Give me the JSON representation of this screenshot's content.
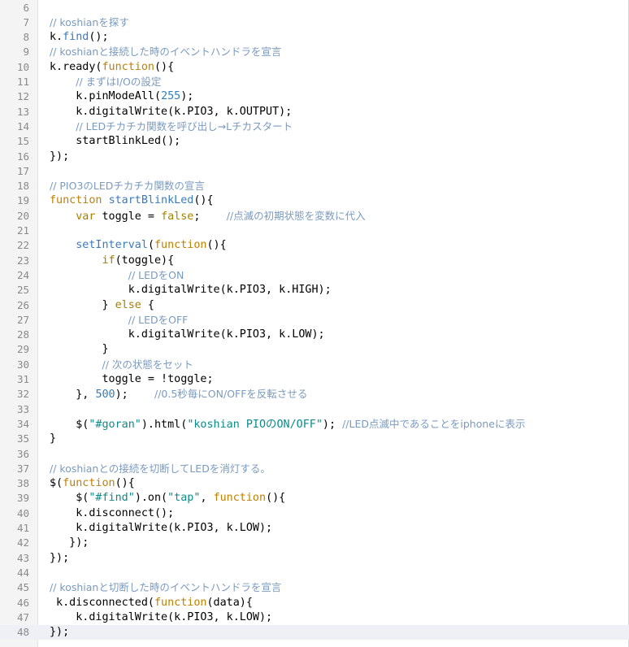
{
  "editor": {
    "lines": [
      {
        "n": "6",
        "t": []
      },
      {
        "n": "7",
        "t": [
          {
            "c": "com",
            "v": "// koshianを探す"
          }
        ]
      },
      {
        "n": "8",
        "t": [
          {
            "c": "obj",
            "v": "k."
          },
          {
            "c": "fn",
            "v": "find"
          },
          {
            "c": "obj",
            "v": "();"
          }
        ]
      },
      {
        "n": "9",
        "t": [
          {
            "c": "com",
            "v": "// koshianと接続した時のイベントハンドラを宣言"
          }
        ]
      },
      {
        "n": "10",
        "t": [
          {
            "c": "obj",
            "v": "k.ready("
          },
          {
            "c": "kw",
            "v": "function"
          },
          {
            "c": "obj",
            "v": "(){"
          }
        ]
      },
      {
        "n": "11",
        "t": [
          {
            "c": "obj",
            "v": "    "
          },
          {
            "c": "com",
            "v": "// まずはI/Oの設定"
          }
        ]
      },
      {
        "n": "12",
        "t": [
          {
            "c": "obj",
            "v": "    k.pinModeAll("
          },
          {
            "c": "num",
            "v": "255"
          },
          {
            "c": "obj",
            "v": ");"
          }
        ]
      },
      {
        "n": "13",
        "t": [
          {
            "c": "obj",
            "v": "    k.digitalWrite(k.PIO3, k.OUTPUT);"
          }
        ]
      },
      {
        "n": "14",
        "t": [
          {
            "c": "obj",
            "v": "    "
          },
          {
            "c": "com",
            "v": "// LEDチカチカ関数を呼び出し→Lチカスタート"
          }
        ]
      },
      {
        "n": "15",
        "t": [
          {
            "c": "obj",
            "v": "    startBlinkLed();"
          }
        ]
      },
      {
        "n": "16",
        "t": [
          {
            "c": "obj",
            "v": "});"
          }
        ]
      },
      {
        "n": "17",
        "t": []
      },
      {
        "n": "18",
        "t": [
          {
            "c": "com",
            "v": "// PIO3のLEDチカチカ関数の宣言"
          }
        ]
      },
      {
        "n": "19",
        "t": [
          {
            "c": "kw",
            "v": "function"
          },
          {
            "c": "obj",
            "v": " "
          },
          {
            "c": "fn",
            "v": "startBlinkLed"
          },
          {
            "c": "obj",
            "v": "(){"
          }
        ]
      },
      {
        "n": "20",
        "t": [
          {
            "c": "obj",
            "v": "    "
          },
          {
            "c": "kw2",
            "v": "var"
          },
          {
            "c": "obj",
            "v": " toggle = "
          },
          {
            "c": "kw2",
            "v": "false"
          },
          {
            "c": "obj",
            "v": ";    "
          },
          {
            "c": "com",
            "v": "//点滅の初期状態を変数に代入"
          }
        ]
      },
      {
        "n": "21",
        "t": []
      },
      {
        "n": "22",
        "t": [
          {
            "c": "obj",
            "v": "    "
          },
          {
            "c": "fn",
            "v": "setInterval"
          },
          {
            "c": "obj",
            "v": "("
          },
          {
            "c": "kw",
            "v": "function"
          },
          {
            "c": "obj",
            "v": "(){"
          }
        ]
      },
      {
        "n": "23",
        "t": [
          {
            "c": "obj",
            "v": "        "
          },
          {
            "c": "kw2",
            "v": "if"
          },
          {
            "c": "obj",
            "v": "(toggle){"
          }
        ]
      },
      {
        "n": "24",
        "t": [
          {
            "c": "obj",
            "v": "            "
          },
          {
            "c": "com",
            "v": "// LEDをON"
          }
        ]
      },
      {
        "n": "25",
        "t": [
          {
            "c": "obj",
            "v": "            k.digitalWrite(k.PIO3, k.HIGH);"
          }
        ]
      },
      {
        "n": "26",
        "t": [
          {
            "c": "obj",
            "v": "        } "
          },
          {
            "c": "kw2",
            "v": "else"
          },
          {
            "c": "obj",
            "v": " {"
          }
        ]
      },
      {
        "n": "27",
        "t": [
          {
            "c": "obj",
            "v": "            "
          },
          {
            "c": "com",
            "v": "// LEDをOFF"
          }
        ]
      },
      {
        "n": "28",
        "t": [
          {
            "c": "obj",
            "v": "            k.digitalWrite(k.PIO3, k.LOW);"
          }
        ]
      },
      {
        "n": "29",
        "t": [
          {
            "c": "obj",
            "v": "        }"
          }
        ]
      },
      {
        "n": "30",
        "t": [
          {
            "c": "obj",
            "v": "        "
          },
          {
            "c": "com",
            "v": "// 次の状態をセット"
          }
        ]
      },
      {
        "n": "31",
        "t": [
          {
            "c": "obj",
            "v": "        toggle = !toggle;"
          }
        ]
      },
      {
        "n": "32",
        "t": [
          {
            "c": "obj",
            "v": "    }, "
          },
          {
            "c": "num",
            "v": "500"
          },
          {
            "c": "obj",
            "v": ");    "
          },
          {
            "c": "com",
            "v": "//0.5秒毎にON/OFFを反転させる"
          }
        ]
      },
      {
        "n": "33",
        "t": []
      },
      {
        "n": "34",
        "t": [
          {
            "c": "obj",
            "v": "    $("
          },
          {
            "c": "str",
            "v": "\"#goran\""
          },
          {
            "c": "obj",
            "v": ").html("
          },
          {
            "c": "str",
            "v": "\"koshian PIOのON/OFF\""
          },
          {
            "c": "obj",
            "v": "); "
          },
          {
            "c": "com",
            "v": "//LED点滅中であることをiphoneに表示"
          }
        ]
      },
      {
        "n": "35",
        "t": [
          {
            "c": "obj",
            "v": "}"
          }
        ]
      },
      {
        "n": "36",
        "t": []
      },
      {
        "n": "37",
        "t": [
          {
            "c": "com",
            "v": "// koshianとの接続を切断してLEDを消灯する。"
          }
        ]
      },
      {
        "n": "38",
        "t": [
          {
            "c": "obj",
            "v": "$("
          },
          {
            "c": "kw",
            "v": "function"
          },
          {
            "c": "obj",
            "v": "(){"
          }
        ]
      },
      {
        "n": "39",
        "t": [
          {
            "c": "obj",
            "v": "    $("
          },
          {
            "c": "str",
            "v": "\"#find\""
          },
          {
            "c": "obj",
            "v": ").on("
          },
          {
            "c": "str",
            "v": "\"tap\""
          },
          {
            "c": "obj",
            "v": ", "
          },
          {
            "c": "kw",
            "v": "function"
          },
          {
            "c": "obj",
            "v": "(){"
          }
        ]
      },
      {
        "n": "40",
        "t": [
          {
            "c": "obj",
            "v": "    k.disconnect();"
          }
        ]
      },
      {
        "n": "41",
        "t": [
          {
            "c": "obj",
            "v": "    k.digitalWrite(k.PIO3, k.LOW);"
          }
        ]
      },
      {
        "n": "42",
        "t": [
          {
            "c": "obj",
            "v": "   });"
          }
        ]
      },
      {
        "n": "43",
        "t": [
          {
            "c": "obj",
            "v": "});"
          }
        ]
      },
      {
        "n": "44",
        "t": []
      },
      {
        "n": "45",
        "t": [
          {
            "c": "com",
            "v": "// koshianと切断した時のイベントハンドラを宣言"
          }
        ]
      },
      {
        "n": "46",
        "t": [
          {
            "c": "obj",
            "v": " k.disconnected("
          },
          {
            "c": "kw",
            "v": "function"
          },
          {
            "c": "obj",
            "v": "(data){"
          }
        ]
      },
      {
        "n": "47",
        "t": [
          {
            "c": "obj",
            "v": "    k.digitalWrite(k.PIO3, k.LOW);"
          }
        ]
      },
      {
        "n": "48",
        "t": [
          {
            "c": "obj",
            "v": "});"
          }
        ],
        "current": true
      }
    ]
  }
}
